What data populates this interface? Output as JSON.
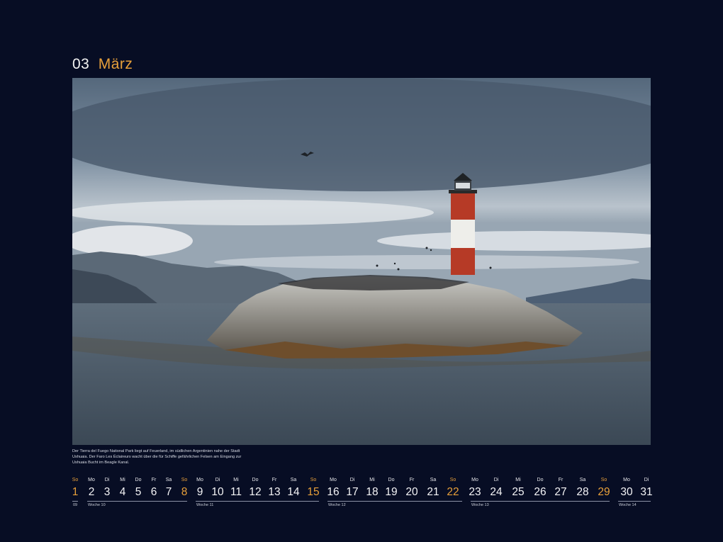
{
  "header": {
    "month_number": "03",
    "month_name": "März"
  },
  "photo": {
    "alt": "lighthouse-on-rocky-island"
  },
  "caption": "Der Tierra del Fuego National Park liegt auf Feuerland, im südlichen Argentinien nahe der Stadt Ushuaia. Der Faro Les Éclaireurs wacht über die für Schiffe gefährlichen Felsen am Eingang zur Ushuaia Bucht im Beagle Kanal.",
  "calendar": {
    "days": [
      {
        "wd": "So",
        "n": "1",
        "sun": true
      },
      {
        "wd": "Mo",
        "n": "2"
      },
      {
        "wd": "Di",
        "n": "3"
      },
      {
        "wd": "Mi",
        "n": "4"
      },
      {
        "wd": "Do",
        "n": "5"
      },
      {
        "wd": "Fr",
        "n": "6"
      },
      {
        "wd": "Sa",
        "n": "7"
      },
      {
        "wd": "So",
        "n": "8",
        "sun": true
      },
      {
        "wd": "Mo",
        "n": "9"
      },
      {
        "wd": "Di",
        "n": "10"
      },
      {
        "wd": "Mi",
        "n": "11"
      },
      {
        "wd": "Do",
        "n": "12"
      },
      {
        "wd": "Fr",
        "n": "13"
      },
      {
        "wd": "Sa",
        "n": "14"
      },
      {
        "wd": "So",
        "n": "15",
        "sun": true
      },
      {
        "wd": "Mo",
        "n": "16"
      },
      {
        "wd": "Di",
        "n": "17"
      },
      {
        "wd": "Mi",
        "n": "18"
      },
      {
        "wd": "Do",
        "n": "19"
      },
      {
        "wd": "Fr",
        "n": "20"
      },
      {
        "wd": "Sa",
        "n": "21"
      },
      {
        "wd": "So",
        "n": "22",
        "sun": true
      },
      {
        "wd": "Mo",
        "n": "23"
      },
      {
        "wd": "Di",
        "n": "24"
      },
      {
        "wd": "Mi",
        "n": "25"
      },
      {
        "wd": "Do",
        "n": "26"
      },
      {
        "wd": "Fr",
        "n": "27"
      },
      {
        "wd": "Sa",
        "n": "28"
      },
      {
        "wd": "So",
        "n": "29",
        "sun": true
      },
      {
        "wd": "Mo",
        "n": "30"
      },
      {
        "wd": "Di",
        "n": "31"
      }
    ],
    "weeks": [
      "09",
      "Woche 10",
      "Woche 11",
      "Woche 12",
      "Woche 13",
      "Woche 14"
    ]
  },
  "colors": {
    "background": "#070d24",
    "accent": "#e8a03a",
    "text": "#f4f4f6"
  }
}
